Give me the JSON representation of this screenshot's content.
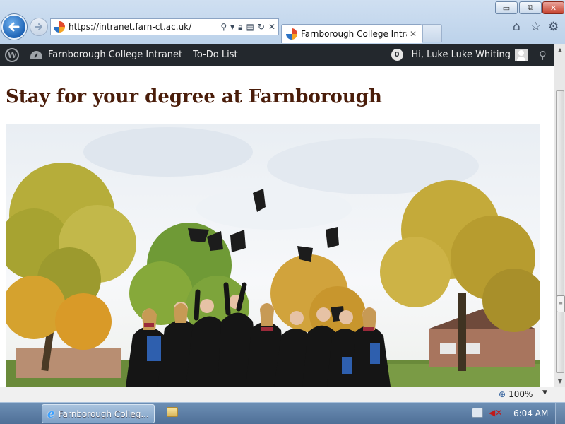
{
  "window": {
    "minimize": "▭",
    "maximize": "⧉",
    "close": "✕"
  },
  "browser": {
    "address": "https://intranet.farn-ct.ac.uk/",
    "tab_title": "Farnborough College Intra...",
    "tab_close": "✕"
  },
  "admin_bar": {
    "site_name": "Farnborough College Intranet",
    "todo": "To-Do List",
    "notifications": "0",
    "greeting": "Hi, Luke Luke Whiting"
  },
  "page": {
    "heading": "Stay for your degree at Farnborough"
  },
  "statusbar": {
    "zoom": "100%"
  },
  "taskbar": {
    "ie_label": "Farnborough Colleg...",
    "clock": "6:04 AM"
  },
  "icons": {
    "back": "back-arrow-icon",
    "forward": "forward-arrow-icon",
    "home": "home-icon",
    "favorites": "star-icon",
    "tools": "gear-icon",
    "search": "search-icon"
  }
}
